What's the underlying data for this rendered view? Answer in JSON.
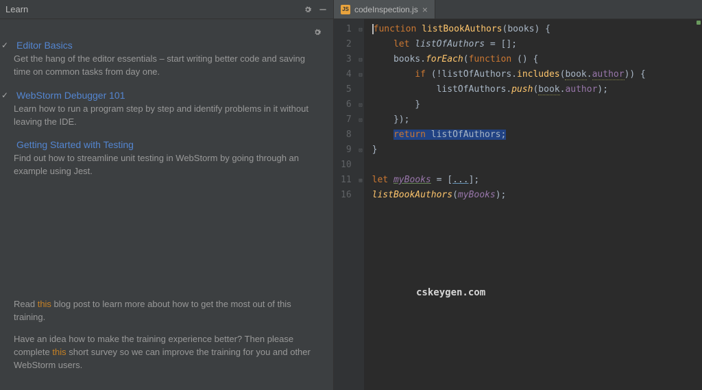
{
  "panel": {
    "title": "Learn"
  },
  "lessons": [
    {
      "done": true,
      "title": "Editor Basics",
      "desc": "Get the hang of the editor essentials – start writing better code and saving time on common tasks from day one."
    },
    {
      "done": true,
      "title": "WebStorm Debugger 101",
      "desc": "Learn how to run a program step by step and identify problems in it without leaving the IDE."
    },
    {
      "done": false,
      "title": "Getting Started with Testing",
      "desc": "Find out how to streamline unit testing in WebStorm by going through an example using Jest."
    }
  ],
  "footer": {
    "p1a": "Read ",
    "p1link": "this",
    "p1b": " blog post to learn more about how to get the most out of this training.",
    "p2a": "Have an idea how to make the training experience better? Then please complete ",
    "p2link": "this",
    "p2b": " short survey so we can improve the training for you and other WebStorm users."
  },
  "tab": {
    "icon": "JS",
    "name": "codeInspection.js"
  },
  "lines": [
    "1",
    "2",
    "3",
    "4",
    "5",
    "6",
    "7",
    "8",
    "9",
    "10",
    "11",
    "16"
  ],
  "code": {
    "l1": {
      "a": "function ",
      "b": "listBookAuthors",
      "c": "(",
      "d": "books",
      "e": ") {"
    },
    "l2": {
      "a": "    ",
      "b": "let ",
      "c": "listOfAuthors",
      "d": " = [];"
    },
    "l3": {
      "a": "    ",
      "b": "books",
      "c": ".",
      "d": "forEach",
      "e": "(",
      "f": "function ",
      "g": "() {"
    },
    "l4": {
      "a": "        ",
      "b": "if ",
      "c": "(!",
      "d": "listOfAuthors",
      "e": ".",
      "f": "includes",
      "g": "(",
      "h": "book",
      "i": ".",
      "j": "author",
      "k": ")) {"
    },
    "l5": {
      "a": "            ",
      "b": "listOfAuthors",
      "c": ".",
      "d": "push",
      "e": "(",
      "f": "book",
      "g": ".",
      "h": "author",
      "i": ");"
    },
    "l6": {
      "a": "        }"
    },
    "l7": {
      "a": "    });"
    },
    "l8": {
      "a": "    ",
      "b": "return ",
      "c": "listOfAuthors",
      "d": ";"
    },
    "l9": {
      "a": "}"
    },
    "l10": {
      "a": ""
    },
    "l11": {
      "a": "let ",
      "b": "myBooks",
      "c": " = [",
      "d": "...",
      "e": "];"
    },
    "l12": {
      "a": "listBookAuthors",
      "b": "(",
      "c": "myBooks",
      "d": ");"
    }
  },
  "watermark": "cskeygen.com"
}
